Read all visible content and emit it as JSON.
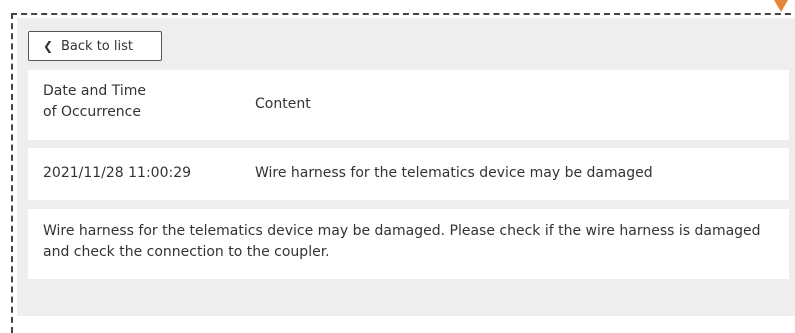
{
  "nav": {
    "back_label": "Back to list"
  },
  "table": {
    "header": {
      "date_line1": "Date and Time",
      "date_line2": "of Occurrence",
      "content": "Content"
    },
    "entry": {
      "datetime": "2021/11/28 11:00:29",
      "content": "Wire harness for the telematics device may be damaged"
    }
  },
  "detail": {
    "text": "Wire harness for the telematics device may be damaged. Please check if the wire harness is damaged and check the connection to the coupler."
  },
  "colors": {
    "panel_background": "#eeeeee",
    "row_background": "#ffffff",
    "marker": "#e8833a"
  },
  "icons": {
    "back": "chevron-left-icon",
    "corner": "triangle-down-icon"
  }
}
